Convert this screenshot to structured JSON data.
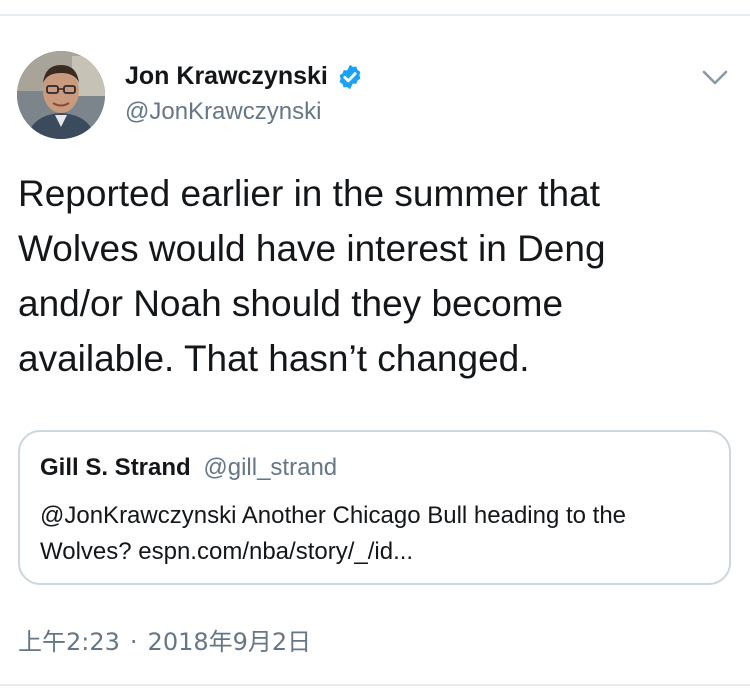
{
  "tweet": {
    "author": {
      "name": "Jon Krawczynski",
      "handle": "@JonKrawczynski",
      "verified": true,
      "avatar_icon": "avatar-photo"
    },
    "menu_icon": "chevron-down-icon",
    "text": "Reported earlier in the summer that\nWolves would have interest in Deng\nand/or Noah should they become\navailable. That hasn’t changed.",
    "quoted_tweet": {
      "name": "Gill S. Strand",
      "handle": "@gill_strand",
      "text": "@JonKrawczynski Another Chicago Bull heading to the Wolves? espn.com/nba/story/_/id..."
    },
    "time": "上午2:23",
    "separator": "·",
    "date": "2018年9月2日"
  },
  "colors": {
    "text_primary": "#14171a",
    "text_secondary": "#657786",
    "verified_blue": "#1da1f2",
    "border": "#ccd6dd"
  }
}
